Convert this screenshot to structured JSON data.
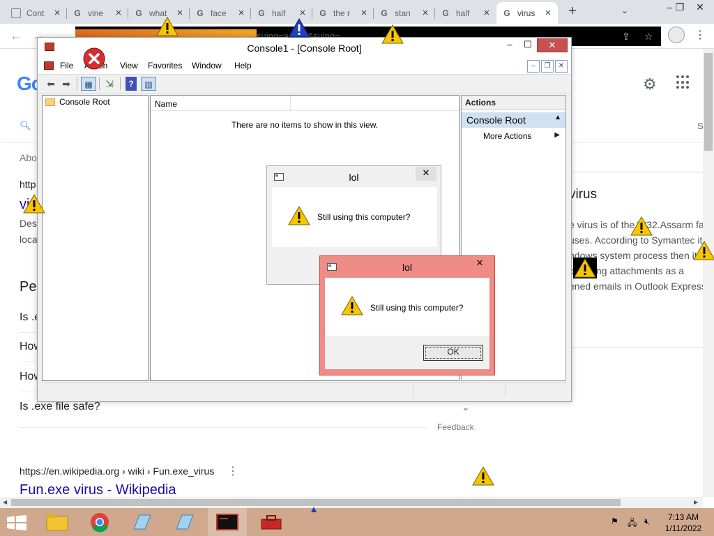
{
  "browser": {
    "tabs": [
      {
        "title": "Cont",
        "icon": "document-icon"
      },
      {
        "title": "vine",
        "icon": "google-icon"
      },
      {
        "title": "what",
        "icon": "google-icon"
      },
      {
        "title": "face",
        "icon": "google-icon"
      },
      {
        "title": "half",
        "icon": "google-icon"
      },
      {
        "title": "the r",
        "icon": "google-icon"
      },
      {
        "title": "stan",
        "icon": "google-icon"
      },
      {
        "title": "half",
        "icon": "google-icon"
      },
      {
        "title": "virus",
        "icon": "google-icon",
        "active": true
      }
    ],
    "new_tab": "+",
    "omnibox_ghost": "suing=active&suing="
  },
  "google": {
    "logo": "Go",
    "tab_s": "S",
    "about": "Abo",
    "http": "http",
    "vi_title": "vi",
    "des": "Des",
    "loca": "loca",
    "people_also_ask": "Pe",
    "faq": [
      "Is .e",
      "How",
      "How",
      "Is .exe file safe?"
    ],
    "feedback": "Feedback",
    "wiki_url": "https://en.wikipedia.org › wiki › Fun.exe_virus",
    "wiki_title": "Fun.exe virus - Wikipedia",
    "kp_title": "virus",
    "kp_lines": [
      "e virus is of the W32.Assarm fam",
      "uses. According to Symantec it",
      "ndows system process then it",
      "preading attachments as a",
      "ened emails in Outlook Express"
    ]
  },
  "mmc": {
    "title": "Console1 - [Console Root]",
    "menus": [
      "File",
      "Action",
      "View",
      "Favorites",
      "Window",
      "Help"
    ],
    "tree_root": "Console Root",
    "column_name": "Name",
    "empty_message": "There are no items to show in this view.",
    "actions_header": "Actions",
    "actions_group": "Console Root",
    "actions_item": "More Actions"
  },
  "dialog1": {
    "title": "lol",
    "message": "Still using this computer?"
  },
  "dialog2": {
    "title": "lol",
    "message": "Still using this computer?",
    "ok": "OK",
    "accent": "#ef8c85"
  },
  "taskbar": {
    "time": "7:13 AM",
    "date": "1/11/2022"
  }
}
